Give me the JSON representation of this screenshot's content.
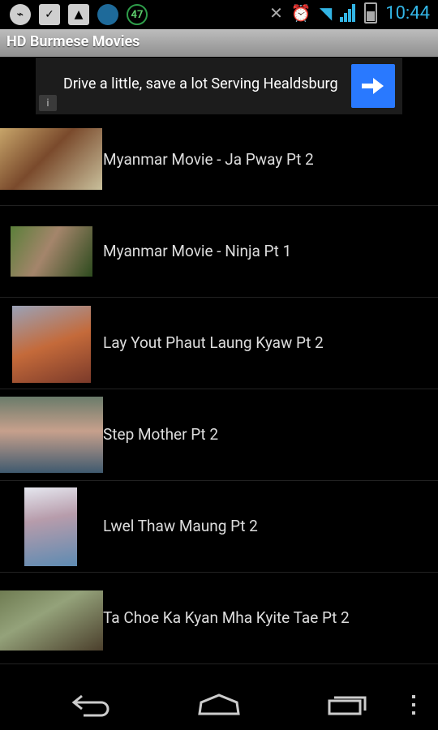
{
  "status_bar": {
    "time": "10:44",
    "notification_badge": "47",
    "icons": [
      "usb-debug-icon",
      "check-icon",
      "image-icon",
      "vpn-globe-icon",
      "download-counter-icon",
      "mute-icon",
      "alarm-icon",
      "wifi-icon",
      "signal-icon",
      "battery-icon"
    ]
  },
  "app": {
    "title": "HD Burmese Movies"
  },
  "ad": {
    "text": "Drive a little, save a lot Serving Healdsburg",
    "info": "i",
    "arrow_color": "#2979ff"
  },
  "movies": [
    {
      "title": "Myanmar Movie - Ja Pway Pt 2"
    },
    {
      "title": "Myanmar Movie - Ninja Pt 1"
    },
    {
      "title": "Lay Yout Phaut Laung Kyaw Pt 2"
    },
    {
      "title": "Step Mother Pt 2"
    },
    {
      "title": "Lwel Thaw Maung Pt 2"
    },
    {
      "title": "Ta Choe Ka Kyan Mha Kyite Tae Pt 2"
    }
  ],
  "colors": {
    "accent": "#33b5e5",
    "background": "#000000"
  }
}
